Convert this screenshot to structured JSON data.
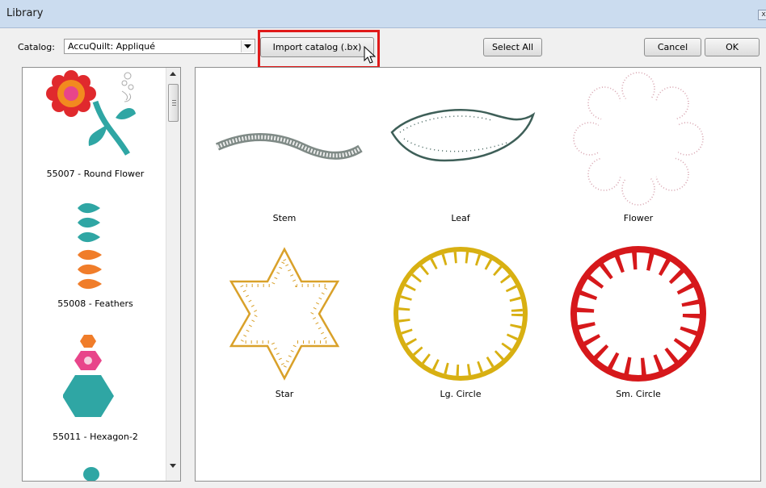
{
  "window": {
    "title": "Library",
    "close_glyph": "x"
  },
  "toolbar": {
    "catalog_label": "Catalog:",
    "catalog_value": "AccuQuilt: Appliqué",
    "import_label": "Import catalog (.bx)",
    "select_all_label": "Select All",
    "cancel_label": "Cancel",
    "ok_label": "OK"
  },
  "catalog_list": {
    "items": [
      {
        "label": "55007 - Round Flower"
      },
      {
        "label": "55008 - Feathers"
      },
      {
        "label": "55011 - Hexagon-2"
      }
    ]
  },
  "gallery": {
    "items": [
      {
        "label": "Stem",
        "color": "#7f8a86"
      },
      {
        "label": "Leaf",
        "color": "#3e5f58"
      },
      {
        "label": "Flower",
        "color": "#d7a2ae"
      },
      {
        "label": "Star",
        "color": "#d9a12a"
      },
      {
        "label": "Lg. Circle",
        "color": "#d8b012"
      },
      {
        "label": "Sm. Circle",
        "color": "#d6181b"
      }
    ]
  },
  "annotation": {
    "highlight_color": "#e01a1a"
  }
}
